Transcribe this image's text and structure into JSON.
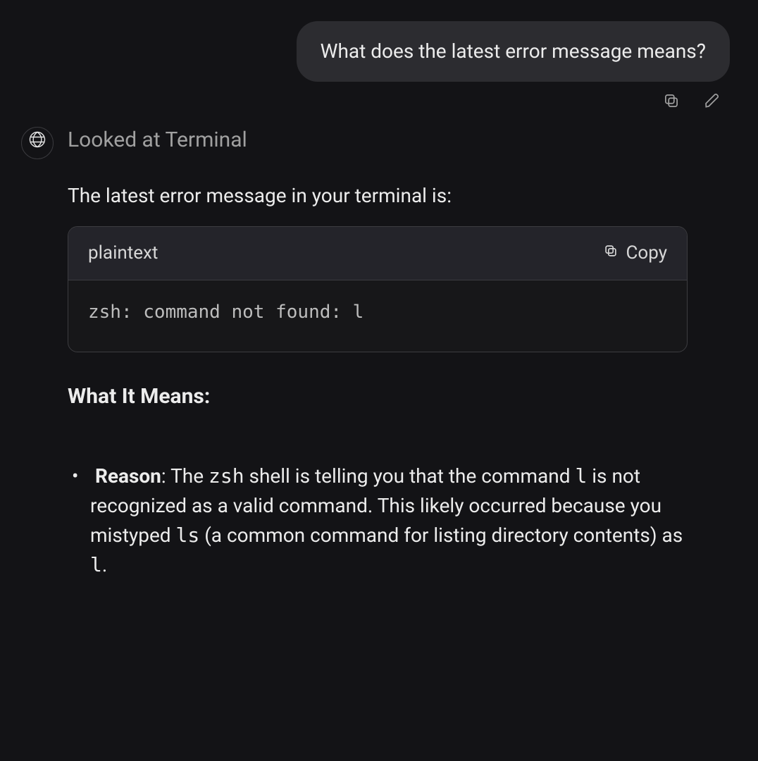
{
  "user_message": "What does the latest error message means?",
  "actions": {
    "copy_tip": "Copy",
    "edit_tip": "Edit"
  },
  "assistant": {
    "tool_line": "Looked at Terminal",
    "intro": "The latest error message in your terminal is:",
    "code": {
      "language": "plaintext",
      "copy_label": "Copy",
      "content": "zsh: command not found: l"
    },
    "section_title": "What It Means:",
    "bullet": {
      "label": "Reason",
      "p1": ": The ",
      "c1": "zsh",
      "p2": " shell is telling you that the command ",
      "c2": "l",
      "p3": " is not recognized as a valid command. This likely occurred because you mistyped ",
      "c3": "ls",
      "p4": " (a common command for listing directory contents) as ",
      "c4": "l",
      "p5": "."
    }
  }
}
